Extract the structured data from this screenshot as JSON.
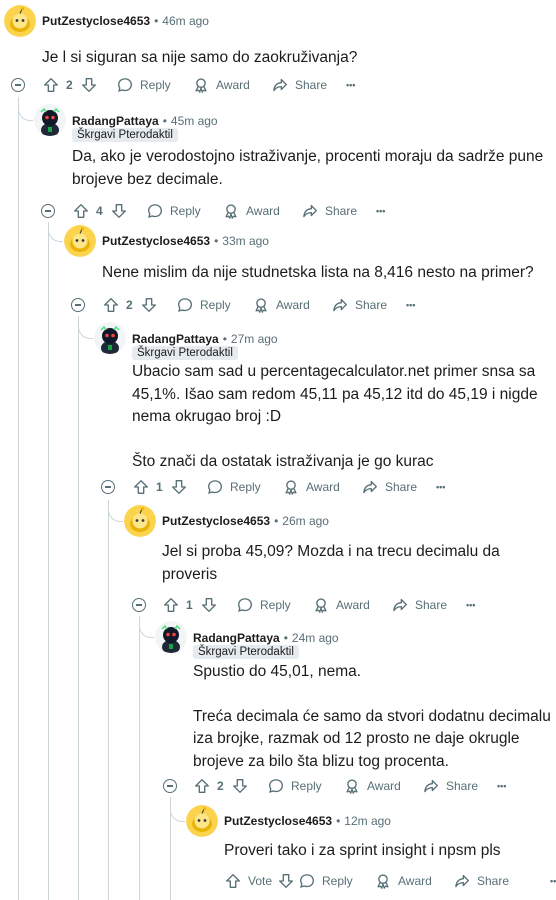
{
  "actions": {
    "reply": "Reply",
    "award": "Award",
    "share": "Share",
    "more": "•••",
    "vote": "Vote"
  },
  "comments": [
    {
      "author": "PutZestyclose4653",
      "sep": "•",
      "time": "46m ago",
      "flair": "",
      "body": [
        "Je l si siguran sa nije samo do zaokruživanja?"
      ],
      "votes": "2",
      "avatar": "yellow"
    },
    {
      "author": "RadangPattaya",
      "sep": "•",
      "time": "45m ago",
      "flair": "Škrgavi Pterodaktil",
      "body": [
        "Da, ako je verodostojno istraživanje, procenti moraju da sadrže pune brojeve bez decimale."
      ],
      "votes": "4",
      "avatar": "dark"
    },
    {
      "author": "PutZestyclose4653",
      "sep": "•",
      "time": "33m ago",
      "flair": "",
      "body": [
        "Nene mislim da nije studnetska lista na 8,416 nesto na primer?"
      ],
      "votes": "2",
      "avatar": "yellow"
    },
    {
      "author": "RadangPattaya",
      "sep": "•",
      "time": "27m ago",
      "flair": "Škrgavi Pterodaktil",
      "body": [
        "Ubacio sam sad u percentagecalculator.net primer snsa sa 45,1%. Išao sam redom 45,11 pa 45,12 itd do 45,19 i nigde nema okrugao broj :D",
        "Što znači da ostatak istraživanja je go kurac"
      ],
      "votes": "1",
      "avatar": "dark"
    },
    {
      "author": "PutZestyclose4653",
      "sep": "•",
      "time": "26m ago",
      "flair": "",
      "body": [
        "Jel si proba 45,09? Mozda i na trecu decimalu da proveris"
      ],
      "votes": "1",
      "avatar": "yellow"
    },
    {
      "author": "RadangPattaya",
      "sep": "•",
      "time": "24m ago",
      "flair": "Škrgavi Pterodaktil",
      "body": [
        "Spustio do 45,01, nema.",
        "Treća decimala će samo da stvori dodatnu decimalu iza brojke, razmak od 12 prosto ne daje okrugle brojeve za bilo šta blizu tog procenta."
      ],
      "votes": "2",
      "avatar": "dark"
    },
    {
      "author": "PutZestyclose4653",
      "sep": "•",
      "time": "12m ago",
      "flair": "",
      "body": [
        "Proveri tako i za sprint insight i npsm pls"
      ],
      "votes": "",
      "avatar": "yellow"
    }
  ]
}
